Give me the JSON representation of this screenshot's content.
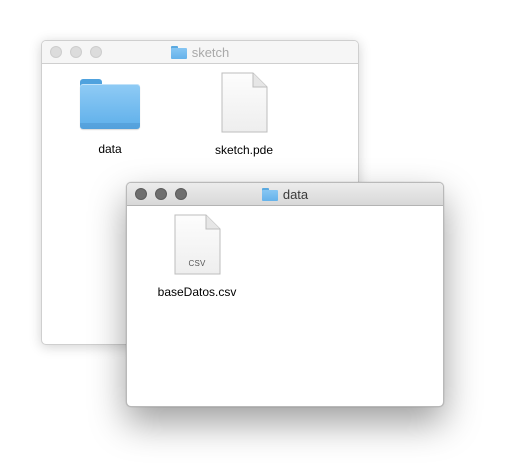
{
  "windows": {
    "sketch": {
      "title": "sketch",
      "items": [
        {
          "label": "data",
          "kind": "folder"
        },
        {
          "label": "sketch.pde",
          "kind": "document"
        }
      ]
    },
    "data": {
      "title": "data",
      "items": [
        {
          "label": "baseDatos.csv",
          "kind": "document",
          "extension_badge": "CSV"
        }
      ]
    }
  },
  "colors": {
    "folder_blue": "#6bb7ec",
    "active_traffic_light": "#6e6e6e",
    "inactive_traffic_light": "#dcdcdc"
  }
}
